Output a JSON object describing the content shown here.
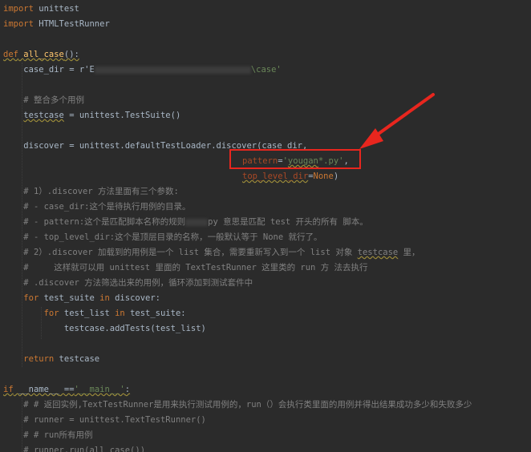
{
  "code": {
    "kw_import": "import",
    "kw_def": "def",
    "kw_for": "for",
    "kw_in": "in",
    "kw_return": "return",
    "kw_if": "if",
    "kw_none": "None",
    "mod_unittest": " unittest",
    "mod_htmlrunner": " HTMLTestRunner",
    "fn_all_case": "all_case",
    "paren_colon": "():",
    "case_dir_prefix": "case_dir = r'E",
    "case_dir_suffix": "\\case'",
    "comment_merge": "# 整合多个用例",
    "testcase_var": "testcase",
    "testsuite_rhs": " = unittest.TestSuite()",
    "discover_lhs": "discover = unittest.defaultTestLoader.discover(case_dir,",
    "pattern_param": "pattern",
    "eq": "=",
    "pattern_value_a": "'",
    "pattern_value_squiggle": "yougan",
    "pattern_value_b": "*.py'",
    "comma": ",",
    "top_level_param": "top_level_dir",
    "paren_close": ")",
    "c1": "# 1）.discover 方法里面有三个参数:",
    "c2": "# - case_dir:这个是待执行用例的目录。",
    "c3a": "# - pattern:这个是匹配脚本名称的规则",
    "c3b": "py 意思是匹配 test 开头的所有 脚本。",
    "c4": "# - top_level_dir:这个是顶层目录的名称，一般默认等于 None 就行了。",
    "c5a": "# 2）.discover 加载到的用例是一个 list 集合，需要重新写入到一个 list 对象 ",
    "c5b": "testcase",
    "c5c": " 里，",
    "c6": "#     这样就可以用 unittest 里面的 TextTestRunner 这里类的 run 方 法去执行",
    "c7": "# .discover 方法筛选出来的用例，循环添加到测试套件中",
    "test_suite": " test_suite ",
    "discover_colon": " discover:",
    "test_list": " test_list ",
    "test_suite_colon": " test_suite:",
    "add_tests": "testcase.addTests(test_list)",
    "testcase_return": " testcase",
    "dunder_name": "__name__",
    "eqeq": " ==",
    "main_str": "'__main__'",
    "colon": ":",
    "m1": "# # 返回实例,TextTestRunner是用来执行测试用例的，run（）会执行类里面的用例并得出结果成功多少和失败多少",
    "m2": "# runner = unittest.TextTestRunner()",
    "m3": "# # run所有用例",
    "m4": "# runner.run(all_case())"
  },
  "colors": {
    "background": "#2b2b2b",
    "keyword": "#cc7832",
    "comment": "#808080",
    "string": "#6a8759",
    "function": "#ffc66d",
    "param": "#aa4926",
    "annotation": "#e8261e"
  }
}
